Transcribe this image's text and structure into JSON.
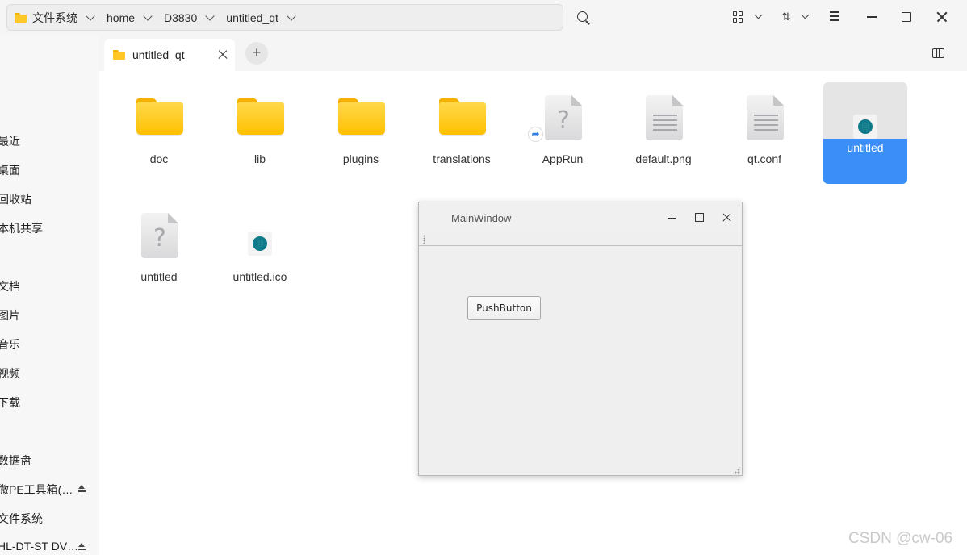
{
  "breadcrumb": {
    "items": [
      "文件系统",
      "home",
      "D3830",
      "untitled_qt"
    ]
  },
  "toolbar": {
    "sort_glyph": "⇅"
  },
  "sidebar": {
    "items": [
      {
        "label": "最近",
        "eject": false
      },
      {
        "label": "桌面",
        "eject": false
      },
      {
        "label": "回收站",
        "eject": false
      },
      {
        "label": "本机共享",
        "eject": false
      },
      {
        "label": "文档",
        "eject": false
      },
      {
        "label": "图片",
        "eject": false
      },
      {
        "label": "音乐",
        "eject": false
      },
      {
        "label": "视频",
        "eject": false
      },
      {
        "label": "下载",
        "eject": false
      },
      {
        "label": "数据盘",
        "eject": false
      },
      {
        "label": "微PE工具箱(…",
        "eject": true
      },
      {
        "label": "文件系统",
        "eject": false
      },
      {
        "label": "HL-DT-ST DV…",
        "eject": true
      }
    ]
  },
  "tabs": [
    {
      "label": "untitled_qt",
      "active": true
    }
  ],
  "add_tab_label": "+",
  "files": [
    {
      "name": "doc",
      "type": "folder",
      "selected": false
    },
    {
      "name": "lib",
      "type": "folder",
      "selected": false
    },
    {
      "name": "plugins",
      "type": "folder",
      "selected": false
    },
    {
      "name": "translations",
      "type": "folder",
      "selected": false
    },
    {
      "name": "AppRun",
      "type": "unknown-symlink",
      "selected": false
    },
    {
      "name": "default.png",
      "type": "text-doc",
      "selected": false
    },
    {
      "name": "qt.conf",
      "type": "text-doc",
      "selected": false
    },
    {
      "name": "untitled",
      "type": "qt-app",
      "selected": true
    },
    {
      "name": "untitled",
      "type": "unknown",
      "selected": false
    },
    {
      "name": "untitled.ico",
      "type": "qt-ico",
      "selected": false
    }
  ],
  "main_window": {
    "title": "MainWindow",
    "button_label": "PushButton"
  },
  "watermark": "CSDN @cw-06",
  "colors": {
    "selection": "#3b8ef7",
    "folder": "#ffc727",
    "qt_teal": "#0e7a8a"
  }
}
